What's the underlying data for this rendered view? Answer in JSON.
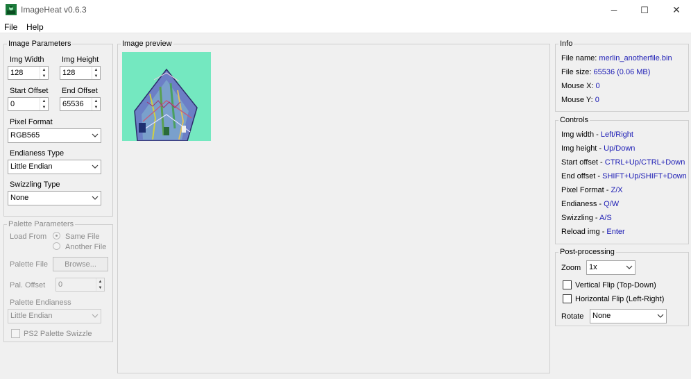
{
  "window": {
    "title": "ImageHeat v0.6.3",
    "minimize_glyph": "─",
    "maximize_glyph": "☐",
    "close_glyph": "✕"
  },
  "menu": {
    "file": "File",
    "help": "Help"
  },
  "image_params": {
    "legend": "Image Parameters",
    "img_width_label": "Img Width",
    "img_width_value": "128",
    "img_height_label": "Img Height",
    "img_height_value": "128",
    "start_offset_label": "Start Offset",
    "start_offset_value": "0",
    "end_offset_label": "End Offset",
    "end_offset_value": "65536",
    "pixel_format_label": "Pixel Format",
    "pixel_format_value": "RGB565",
    "endianess_label": "Endianess Type",
    "endianess_value": "Little Endian",
    "swizzling_label": "Swizzling Type",
    "swizzling_value": "None"
  },
  "palette_params": {
    "legend": "Palette Parameters",
    "load_from_label": "Load From",
    "same_file": "Same File",
    "another_file": "Another File",
    "palette_file_label": "Palette File",
    "browse_button": "Browse...",
    "pal_offset_label": "Pal. Offset",
    "pal_offset_value": "0",
    "palette_endianess_label": "Palette Endianess",
    "palette_endianess_value": "Little Endian",
    "ps2_swizzle_label": "PS2 Palette Swizzle"
  },
  "preview": {
    "legend": "Image preview"
  },
  "info": {
    "legend": "Info",
    "file_name_label": "File name:",
    "file_name_value": "merlin_anotherfile.bin",
    "file_size_label": "File size:",
    "file_size_value": "65536 (0.06 MB)",
    "mouse_x_label": "Mouse X:",
    "mouse_x_value": "0",
    "mouse_y_label": "Mouse Y:",
    "mouse_y_value": "0"
  },
  "controls": {
    "legend": "Controls",
    "items": [
      {
        "label": "Img width - ",
        "keys": "Left/Right"
      },
      {
        "label": "Img height - ",
        "keys": "Up/Down"
      },
      {
        "label": "Start offset - ",
        "keys": "CTRL+Up/CTRL+Down"
      },
      {
        "label": "End offset - ",
        "keys": "SHIFT+Up/SHIFT+Down"
      },
      {
        "label": "Pixel Format - ",
        "keys": "Z/X"
      },
      {
        "label": "Endianess - ",
        "keys": "Q/W"
      },
      {
        "label": "Swizzling - ",
        "keys": "A/S"
      },
      {
        "label": "Reload img - ",
        "keys": "Enter"
      }
    ]
  },
  "post_processing": {
    "legend": "Post-processing",
    "zoom_label": "Zoom",
    "zoom_value": "1x",
    "vertical_flip_label": "Vertical Flip (Top-Down)",
    "horizontal_flip_label": "Horizontal Flip (Left-Right)",
    "rotate_label": "Rotate",
    "rotate_value": "None"
  },
  "colors": {
    "preview_background": "#74e8c0",
    "value_text": "#1a1ab4"
  }
}
